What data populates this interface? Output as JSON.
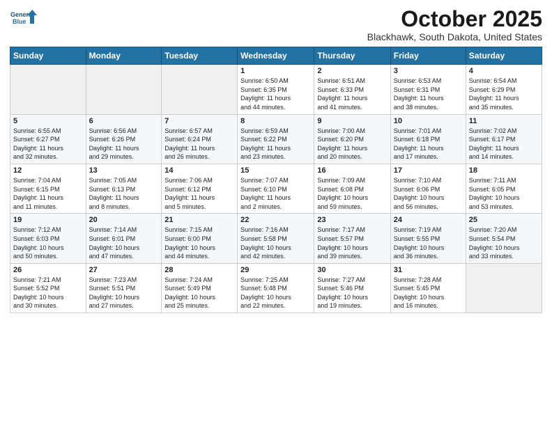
{
  "logo": {
    "line1": "General",
    "line2": "Blue"
  },
  "title": "October 2025",
  "location": "Blackhawk, South Dakota, United States",
  "headers": [
    "Sunday",
    "Monday",
    "Tuesday",
    "Wednesday",
    "Thursday",
    "Friday",
    "Saturday"
  ],
  "weeks": [
    [
      {
        "day": "",
        "info": ""
      },
      {
        "day": "",
        "info": ""
      },
      {
        "day": "",
        "info": ""
      },
      {
        "day": "1",
        "info": "Sunrise: 6:50 AM\nSunset: 6:35 PM\nDaylight: 11 hours\nand 44 minutes."
      },
      {
        "day": "2",
        "info": "Sunrise: 6:51 AM\nSunset: 6:33 PM\nDaylight: 11 hours\nand 41 minutes."
      },
      {
        "day": "3",
        "info": "Sunrise: 6:53 AM\nSunset: 6:31 PM\nDaylight: 11 hours\nand 38 minutes."
      },
      {
        "day": "4",
        "info": "Sunrise: 6:54 AM\nSunset: 6:29 PM\nDaylight: 11 hours\nand 35 minutes."
      }
    ],
    [
      {
        "day": "5",
        "info": "Sunrise: 6:55 AM\nSunset: 6:27 PM\nDaylight: 11 hours\nand 32 minutes."
      },
      {
        "day": "6",
        "info": "Sunrise: 6:56 AM\nSunset: 6:26 PM\nDaylight: 11 hours\nand 29 minutes."
      },
      {
        "day": "7",
        "info": "Sunrise: 6:57 AM\nSunset: 6:24 PM\nDaylight: 11 hours\nand 26 minutes."
      },
      {
        "day": "8",
        "info": "Sunrise: 6:59 AM\nSunset: 6:22 PM\nDaylight: 11 hours\nand 23 minutes."
      },
      {
        "day": "9",
        "info": "Sunrise: 7:00 AM\nSunset: 6:20 PM\nDaylight: 11 hours\nand 20 minutes."
      },
      {
        "day": "10",
        "info": "Sunrise: 7:01 AM\nSunset: 6:18 PM\nDaylight: 11 hours\nand 17 minutes."
      },
      {
        "day": "11",
        "info": "Sunrise: 7:02 AM\nSunset: 6:17 PM\nDaylight: 11 hours\nand 14 minutes."
      }
    ],
    [
      {
        "day": "12",
        "info": "Sunrise: 7:04 AM\nSunset: 6:15 PM\nDaylight: 11 hours\nand 11 minutes."
      },
      {
        "day": "13",
        "info": "Sunrise: 7:05 AM\nSunset: 6:13 PM\nDaylight: 11 hours\nand 8 minutes."
      },
      {
        "day": "14",
        "info": "Sunrise: 7:06 AM\nSunset: 6:12 PM\nDaylight: 11 hours\nand 5 minutes."
      },
      {
        "day": "15",
        "info": "Sunrise: 7:07 AM\nSunset: 6:10 PM\nDaylight: 11 hours\nand 2 minutes."
      },
      {
        "day": "16",
        "info": "Sunrise: 7:09 AM\nSunset: 6:08 PM\nDaylight: 10 hours\nand 59 minutes."
      },
      {
        "day": "17",
        "info": "Sunrise: 7:10 AM\nSunset: 6:06 PM\nDaylight: 10 hours\nand 56 minutes."
      },
      {
        "day": "18",
        "info": "Sunrise: 7:11 AM\nSunset: 6:05 PM\nDaylight: 10 hours\nand 53 minutes."
      }
    ],
    [
      {
        "day": "19",
        "info": "Sunrise: 7:12 AM\nSunset: 6:03 PM\nDaylight: 10 hours\nand 50 minutes."
      },
      {
        "day": "20",
        "info": "Sunrise: 7:14 AM\nSunset: 6:01 PM\nDaylight: 10 hours\nand 47 minutes."
      },
      {
        "day": "21",
        "info": "Sunrise: 7:15 AM\nSunset: 6:00 PM\nDaylight: 10 hours\nand 44 minutes."
      },
      {
        "day": "22",
        "info": "Sunrise: 7:16 AM\nSunset: 5:58 PM\nDaylight: 10 hours\nand 42 minutes."
      },
      {
        "day": "23",
        "info": "Sunrise: 7:17 AM\nSunset: 5:57 PM\nDaylight: 10 hours\nand 39 minutes."
      },
      {
        "day": "24",
        "info": "Sunrise: 7:19 AM\nSunset: 5:55 PM\nDaylight: 10 hours\nand 36 minutes."
      },
      {
        "day": "25",
        "info": "Sunrise: 7:20 AM\nSunset: 5:54 PM\nDaylight: 10 hours\nand 33 minutes."
      }
    ],
    [
      {
        "day": "26",
        "info": "Sunrise: 7:21 AM\nSunset: 5:52 PM\nDaylight: 10 hours\nand 30 minutes."
      },
      {
        "day": "27",
        "info": "Sunrise: 7:23 AM\nSunset: 5:51 PM\nDaylight: 10 hours\nand 27 minutes."
      },
      {
        "day": "28",
        "info": "Sunrise: 7:24 AM\nSunset: 5:49 PM\nDaylight: 10 hours\nand 25 minutes."
      },
      {
        "day": "29",
        "info": "Sunrise: 7:25 AM\nSunset: 5:48 PM\nDaylight: 10 hours\nand 22 minutes."
      },
      {
        "day": "30",
        "info": "Sunrise: 7:27 AM\nSunset: 5:46 PM\nDaylight: 10 hours\nand 19 minutes."
      },
      {
        "day": "31",
        "info": "Sunrise: 7:28 AM\nSunset: 5:45 PM\nDaylight: 10 hours\nand 16 minutes."
      },
      {
        "day": "",
        "info": ""
      }
    ]
  ]
}
